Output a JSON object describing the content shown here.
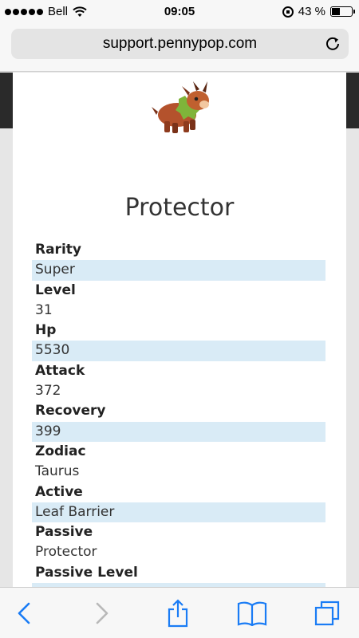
{
  "status_bar": {
    "carrier": "Bell",
    "time": "09:05",
    "battery": "43 %",
    "battery_level": 0.43,
    "icons": [
      "signal-dots-icon",
      "wifi-icon",
      "rotation-lock-icon",
      "battery-icon"
    ]
  },
  "browser": {
    "url": "support.pennypop.com",
    "toolbar_icons": [
      "back-icon",
      "forward-icon",
      "share-icon",
      "bookmarks-icon",
      "tabs-icon"
    ]
  },
  "page": {
    "title": "Protector",
    "stats": [
      {
        "label": "Rarity",
        "value": "Super"
      },
      {
        "label": "Level",
        "value": "31"
      },
      {
        "label": "Hp",
        "value": "5530"
      },
      {
        "label": "Attack",
        "value": "372"
      },
      {
        "label": "Recovery",
        "value": "399"
      },
      {
        "label": "Zodiac",
        "value": "Taurus"
      },
      {
        "label": "Active",
        "value": "Leaf Barrier"
      },
      {
        "label": "Passive",
        "value": "Protector"
      },
      {
        "label": "Passive Level",
        "value": ""
      }
    ]
  },
  "colors": {
    "row_highlight": "#d9ebf6",
    "ios_blue": "#1a7cf5"
  }
}
